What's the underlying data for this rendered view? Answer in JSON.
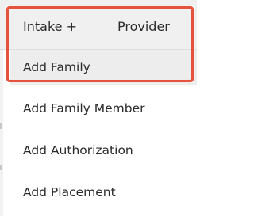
{
  "nav": {
    "intake_label": "Intake +",
    "provider_label": "Provider"
  },
  "dropdown": {
    "items": [
      {
        "label": "Add Family",
        "highlighted": true
      },
      {
        "label": "Add Family Member"
      },
      {
        "label": "Add Authorization"
      },
      {
        "label": "Add Placement"
      }
    ]
  },
  "colors": {
    "highlight_border": "#e5533e",
    "nav_background": "#f0f0f0",
    "active_item_background": "#ededed"
  }
}
